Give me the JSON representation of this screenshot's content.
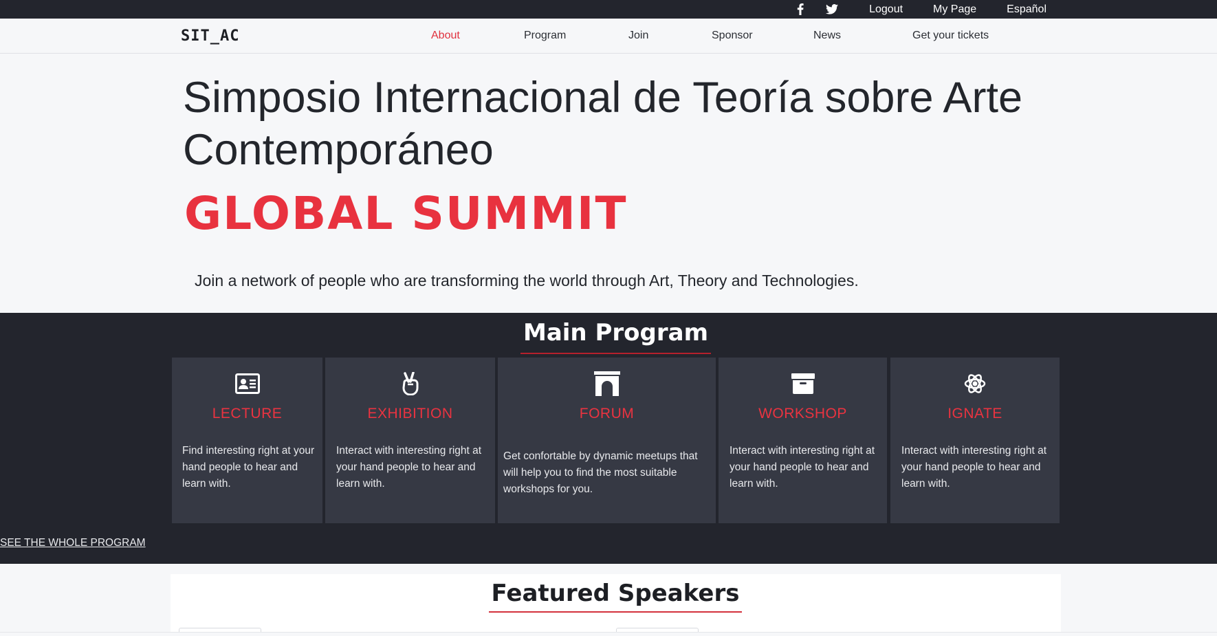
{
  "topbar": {
    "social": [
      {
        "name": "facebook-icon"
      },
      {
        "name": "twitter-icon"
      }
    ],
    "logout": "Logout",
    "my_page": "My Page",
    "language": "Español"
  },
  "navbar": {
    "brand": "SIT_AC",
    "items": [
      {
        "label": "About",
        "active": true
      },
      {
        "label": "Program"
      },
      {
        "label": "Join"
      },
      {
        "label": "Sponsor"
      },
      {
        "label": "News"
      },
      {
        "label": "Get your tickets"
      }
    ]
  },
  "hero": {
    "title": "Simposio Internacional de Teoría sobre Arte Contemporáneo",
    "subtitle": "GLOBAL SUMMIT",
    "tagline": "Join a network of people who are transforming the world through Art, Theory and Technologies."
  },
  "program": {
    "heading": "Main Program",
    "cards": [
      {
        "icon": "id-card-icon",
        "title": "LECTURE",
        "text": "Find interesting right at your hand people to hear and learn with."
      },
      {
        "icon": "peace-hand-icon",
        "title": "EXHIBITION",
        "text": "Interact with interesting right at your hand people to hear and learn with."
      },
      {
        "icon": "archway-icon",
        "title": "FORUM",
        "text": "Get confortable by dynamic meetups that will help you to find the most suitable workshops for you."
      },
      {
        "icon": "archive-box-icon",
        "title": "WORKSHOP",
        "text": "Interact with interesting right at your hand people to hear and learn with."
      },
      {
        "icon": "atom-icon",
        "title": "IGNATE",
        "text": "Interact with interesting right at your hand people to hear and learn with."
      }
    ],
    "see_all": "SEE THE WHOLE PROGRAM"
  },
  "speakers": {
    "heading": "Featured Speakers"
  },
  "colors": {
    "accent": "#e8323f",
    "dark_band": "#23252d",
    "card_bg": "#363944",
    "page_bg": "#f6f7f9"
  }
}
